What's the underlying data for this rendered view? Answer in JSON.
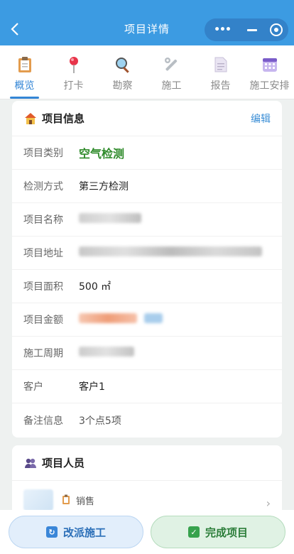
{
  "header": {
    "title": "项目详情",
    "back_icon": "chevron-left-icon",
    "menu_dots": "•••"
  },
  "tabs": [
    {
      "label": "概览",
      "icon": "clipboard-icon",
      "active": true
    },
    {
      "label": "打卡",
      "icon": "pin-icon",
      "active": false
    },
    {
      "label": "勘察",
      "icon": "magnifier-icon",
      "active": false
    },
    {
      "label": "施工",
      "icon": "wrench-icon",
      "active": false
    },
    {
      "label": "报告",
      "icon": "document-icon",
      "active": false
    },
    {
      "label": "施工安排",
      "icon": "calendar-icon",
      "active": false
    }
  ],
  "info": {
    "title": "项目信息",
    "edit_label": "编辑",
    "rows": [
      {
        "label": "项目类别",
        "value": "空气检测"
      },
      {
        "label": "检测方式",
        "value": "第三方检测"
      },
      {
        "label": "项目名称",
        "value": ""
      },
      {
        "label": "项目地址",
        "value": ""
      },
      {
        "label": "项目面积",
        "value": "500 ㎡"
      },
      {
        "label": "项目金额",
        "value": ""
      },
      {
        "label": "施工周期",
        "value": ""
      },
      {
        "label": "客户",
        "value": "客户1"
      },
      {
        "label": "备注信息",
        "value": "3个点5项"
      }
    ]
  },
  "personnel": {
    "title": "项目人员",
    "person": {
      "role": "销售",
      "chevron": "›"
    }
  },
  "actions": {
    "reassign_label": "改派施工",
    "complete_label": "完成项目"
  },
  "colors": {
    "primary": "#3c9be2",
    "accent_blue": "#3486d6",
    "accent_green": "#2e8a2a"
  }
}
